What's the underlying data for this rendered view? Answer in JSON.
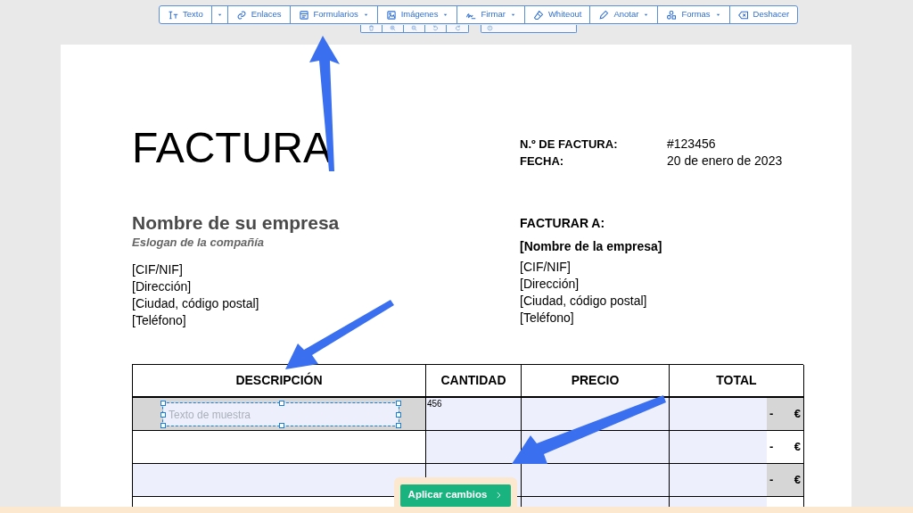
{
  "toolbar": [
    {
      "kind": "text",
      "label": "Texto"
    },
    {
      "kind": "caret"
    },
    {
      "kind": "link",
      "label": "Enlaces"
    },
    {
      "kind": "form",
      "label": "Formularios",
      "has_menu": true
    },
    {
      "kind": "image",
      "label": "Imágenes",
      "has_menu": true
    },
    {
      "kind": "sign",
      "label": "Firmar",
      "has_menu": true
    },
    {
      "kind": "whiteout",
      "label": "Whiteout"
    },
    {
      "kind": "annotate",
      "label": "Anotar",
      "has_menu": true
    },
    {
      "kind": "shapes",
      "label": "Formas",
      "has_menu": true
    },
    {
      "kind": "undo",
      "label": "Deshacer"
    }
  ],
  "page_tools": [
    {
      "kind": "delete"
    },
    {
      "kind": "zoom-in"
    },
    {
      "kind": "zoom-out"
    },
    {
      "kind": "rotate-left"
    },
    {
      "kind": "rotate-right"
    },
    {
      "kind": "insert"
    }
  ],
  "document": {
    "title": "FACTURA",
    "meta": [
      {
        "label": "N.º DE FACTURA:",
        "value": "#123456"
      },
      {
        "label": "FECHA:",
        "value": "20 de enero de 2023"
      }
    ],
    "company": {
      "name": "Nombre de su empresa",
      "slogan": "Eslogan de la compañía",
      "lines": [
        "[CIF/NIF]",
        "[Dirección]",
        "[Ciudad, código postal]",
        "[Teléfono]"
      ]
    },
    "bill_to": {
      "heading": "FACTURAR A:",
      "name": "[Nombre de la empresa]",
      "lines": [
        "[CIF/NIF]",
        "[Dirección]",
        "[Ciudad, código postal]",
        "[Teléfono]"
      ]
    },
    "table": {
      "columns": [
        "DESCRIPCIÓN",
        "CANTIDAD",
        "PRECIO",
        "TOTAL"
      ],
      "rows": [
        {
          "selected": true,
          "shaded": true,
          "description_field": {
            "placeholder": "Texto de muestra"
          },
          "cantidad": "456",
          "total_dash": "-",
          "total_currency": "€"
        },
        {
          "selected": false,
          "shaded": false,
          "total_dash": "-",
          "total_currency": "€"
        },
        {
          "selected": false,
          "shaded": true,
          "total_dash": "-",
          "total_currency": "€"
        },
        {
          "selected": false,
          "shaded": false
        }
      ]
    }
  },
  "apply_button": {
    "label": "Aplicar cambios"
  }
}
